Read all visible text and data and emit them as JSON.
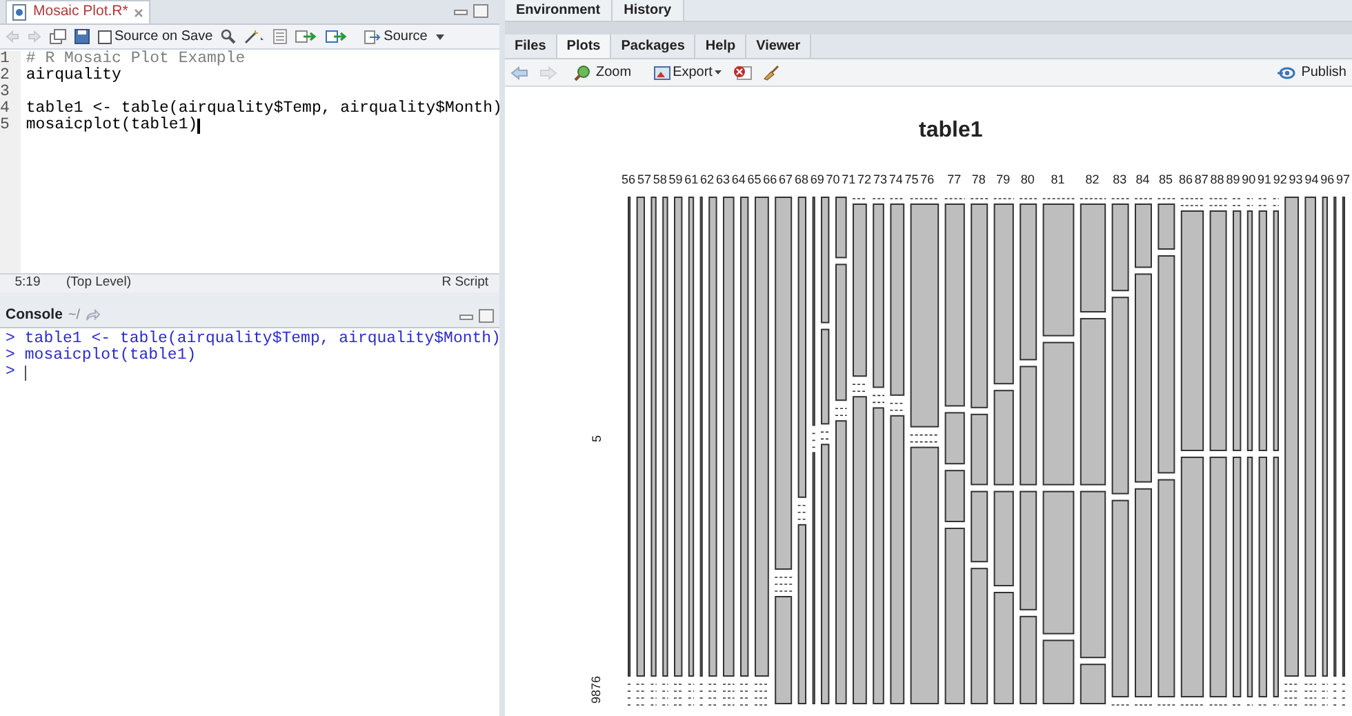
{
  "editor": {
    "tab": {
      "title": "Mosaic Plot.R*",
      "selected": true
    },
    "toolbar": {
      "source_on_save": {
        "label": "Source on Save",
        "checked": false
      },
      "source_button": "Source"
    },
    "lines": [
      {
        "number": "1",
        "code": "# R Mosaic Plot Example",
        "kind": "comment"
      },
      {
        "number": "2",
        "code": "airquality",
        "kind": "code"
      },
      {
        "number": "3",
        "kind": "blank"
      },
      {
        "number": "4",
        "code": "table1 <- table(airquality$Temp, airquality$Month)",
        "kind": "code"
      },
      {
        "number": "5",
        "code": "mosaicplot(table1)",
        "kind": "code",
        "cursor": true
      }
    ],
    "status": {
      "position": "5:19",
      "scope": "(Top Level)",
      "file_type": "R Script"
    }
  },
  "console": {
    "title": "Console",
    "path": "~/",
    "lines": [
      {
        "prompt": ">",
        "code": "table1 <- table(airquality$Temp, airquality$Month)"
      },
      {
        "prompt": ">",
        "code": "mosaicplot(table1)"
      },
      {
        "prompt": ">",
        "cursor": true
      }
    ]
  },
  "top_right_tabs": [
    {
      "label": "Environment",
      "selected": false
    },
    {
      "label": "History",
      "selected": false
    }
  ],
  "plot_tabs": [
    {
      "label": "Files",
      "selected": false
    },
    {
      "label": "Plots",
      "selected": true
    },
    {
      "label": "Packages",
      "selected": false
    },
    {
      "label": "Help",
      "selected": false
    },
    {
      "label": "Viewer",
      "selected": false
    }
  ],
  "plot_toolbar": {
    "zoom": "Zoom",
    "export": "Export",
    "publish": "Publish"
  },
  "plot": {
    "title": "table1",
    "x_labels": [
      "56",
      "57",
      "58",
      "59",
      "61",
      "62",
      "63",
      "64",
      "65",
      "66",
      "67",
      "68",
      "69",
      "70",
      "71",
      "72",
      "73",
      "74",
      "75",
      "76",
      "77",
      "78",
      "79",
      "80",
      "81",
      "82",
      "83",
      "84",
      "85",
      "86",
      "87",
      "88",
      "89",
      "90",
      "91",
      "92",
      "93",
      "94",
      "96",
      "97"
    ],
    "y_labels": [
      "5",
      "9876"
    ]
  }
}
